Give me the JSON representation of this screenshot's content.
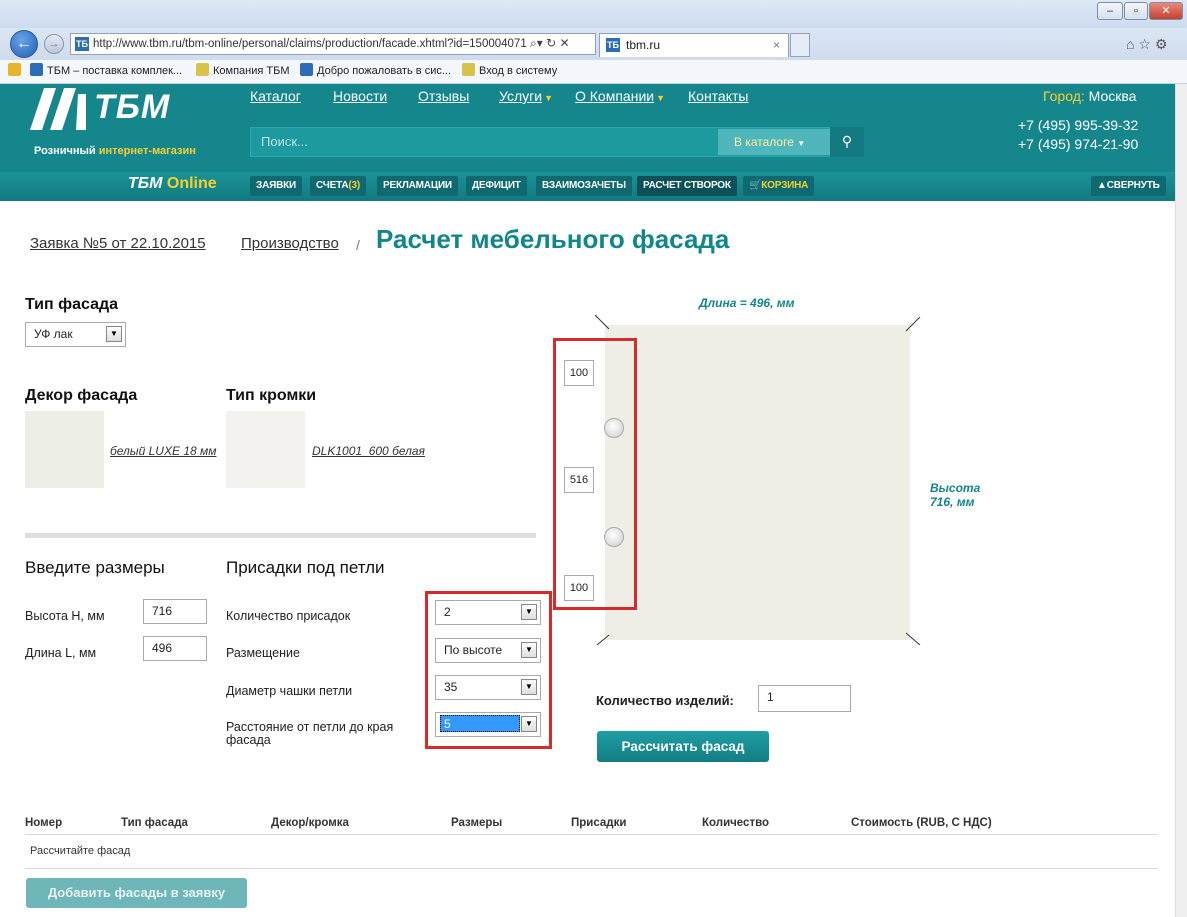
{
  "browser": {
    "url": "http://www.tbm.ru/tbm-online/personal/claims/production/facade.xhtml?id=150004071",
    "tab_title": "tbm.ru",
    "favorites": [
      "ТБМ – поставка комплек...",
      "Компания ТБМ",
      "Добро пожаловать в сис...",
      "Вход в систему"
    ]
  },
  "header": {
    "logo": "ТБМ",
    "tagline_white": "Розничный",
    "tagline_yellow": "интернет-магазин",
    "online_logo_a": "ТБМ",
    "online_logo_b": "Online",
    "nav": [
      "Каталог",
      "Новости",
      "Отзывы",
      "Услуги",
      "О Компании",
      "Контакты"
    ],
    "city_label": "Город:",
    "city": "Москва",
    "phone1": "+7 (495) 995-39-32",
    "phone2": "+7 (495) 974-21-90",
    "search_placeholder": "Поиск...",
    "search_scope": "В каталоге",
    "tabs": [
      "ЗАЯВКИ",
      "СЧЕТА",
      "РЕКЛАМАЦИИ",
      "ДЕФИЦИТ",
      "ВЗАИМОЗАЧЕТЫ",
      "РАСЧЕТ СТВОРОК",
      "КОРЗИНА"
    ],
    "invoices_count": "(3)",
    "collapse": "СВЕРНУТЬ"
  },
  "breadcrumb": {
    "order": "Заявка №5 от 22.10.2015",
    "production": "Производство",
    "separator": "/",
    "title": "Расчет мебельного фасада"
  },
  "form": {
    "facade_type_label": "Тип фасада",
    "facade_type_value": "УФ лак",
    "decor_label": "Декор фасада",
    "decor_value": "белый LUXE 18 мм",
    "edge_label": "Тип кромки",
    "edge_value": "DLK1001_600 белая",
    "sizes_label": "Введите размеры",
    "height_label": "Высота Н, мм",
    "height_value": "716",
    "length_label": "Длина L, мм",
    "length_value": "496",
    "hinges_label": "Присадки под петли",
    "hinge_count_label": "Количество присадок",
    "hinge_count_value": "2",
    "placement_label": "Размещение",
    "placement_value": "По высоте",
    "cup_diameter_label": "Диаметр чашки петли",
    "cup_diameter_value": "35",
    "edge_distance_label_1": "Расстояние от петли до края",
    "edge_distance_label_2": "фасада",
    "edge_distance_value": "5"
  },
  "preview": {
    "length_caption": "Длина = 496, мм",
    "height_caption_1": "Высота",
    "height_caption_2": "716, мм",
    "dim_top": "100",
    "dim_mid": "516",
    "dim_bottom": "100"
  },
  "qty_label": "Количество изделий:",
  "qty_value": "1",
  "calc_button": "Рассчитать фасад",
  "table": {
    "headers": [
      "Номер",
      "Тип фасада",
      "Декор/кромка",
      "Размеры",
      "Присадки",
      "Количество",
      "Стоимость (RUB, С НДС)"
    ],
    "empty_text": "Рассчитайте фасад"
  },
  "add_button": "Добавить фасады в заявку",
  "colors": {
    "brand": "#16868d",
    "accent_yellow": "#f5d030",
    "highlight": "#d62b2b"
  }
}
